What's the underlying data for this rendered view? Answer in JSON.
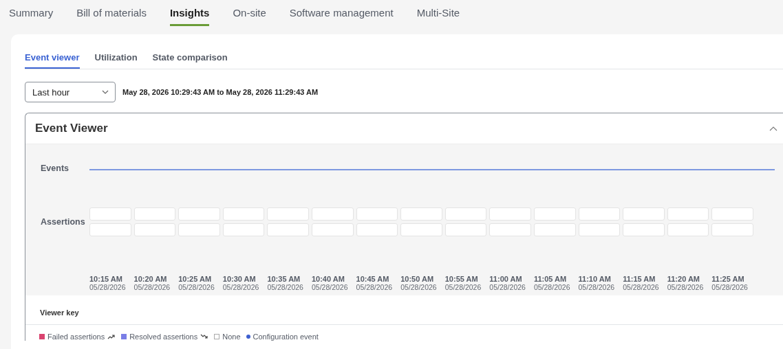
{
  "top_tabs": [
    {
      "label": "Summary",
      "selected": false
    },
    {
      "label": "Bill of materials",
      "selected": false
    },
    {
      "label": "Insights",
      "selected": true
    },
    {
      "label": "On-site",
      "selected": false
    },
    {
      "label": "Software management",
      "selected": false
    },
    {
      "label": "Multi-Site",
      "selected": false
    }
  ],
  "sub_tabs": [
    {
      "label": "Event viewer",
      "selected": true
    },
    {
      "label": "Utilization",
      "selected": false
    },
    {
      "label": "State comparison",
      "selected": false
    }
  ],
  "range_select": {
    "value": "Last hour"
  },
  "range_text": "May 28, 2026 10:29:43 AM to May 28, 2026 11:29:43 AM",
  "event_viewer": {
    "title": "Event Viewer",
    "expanded": true,
    "events_label": "Events",
    "assertions_label": "Assertions",
    "time_labels": [
      {
        "time": "10:15 AM",
        "date": "05/28/2026"
      },
      {
        "time": "10:20 AM",
        "date": "05/28/2026"
      },
      {
        "time": "10:25 AM",
        "date": "05/28/2026"
      },
      {
        "time": "10:30 AM",
        "date": "05/28/2026"
      },
      {
        "time": "10:35 AM",
        "date": "05/28/2026"
      },
      {
        "time": "10:40 AM",
        "date": "05/28/2026"
      },
      {
        "time": "10:45 AM",
        "date": "05/28/2026"
      },
      {
        "time": "10:50 AM",
        "date": "05/28/2026"
      },
      {
        "time": "10:55 AM",
        "date": "05/28/2026"
      },
      {
        "time": "11:00 AM",
        "date": "05/28/2026"
      },
      {
        "time": "11:05 AM",
        "date": "05/28/2026"
      },
      {
        "time": "11:10 AM",
        "date": "05/28/2026"
      },
      {
        "time": "11:15 AM",
        "date": "05/28/2026"
      },
      {
        "time": "11:20 AM",
        "date": "05/28/2026"
      },
      {
        "time": "11:25 AM",
        "date": "05/28/2026"
      }
    ]
  },
  "viewer_key": {
    "title": "Viewer key",
    "items": [
      {
        "kind": "rising",
        "label": "Failed assertions",
        "color": "#d9436f"
      },
      {
        "kind": "falling",
        "label": "Resolved assertions",
        "color": "#7a7ee6"
      },
      {
        "kind": "empty",
        "label": "None"
      },
      {
        "kind": "dot",
        "label": "Configuration event",
        "color": "#3d5fd0"
      }
    ]
  }
}
